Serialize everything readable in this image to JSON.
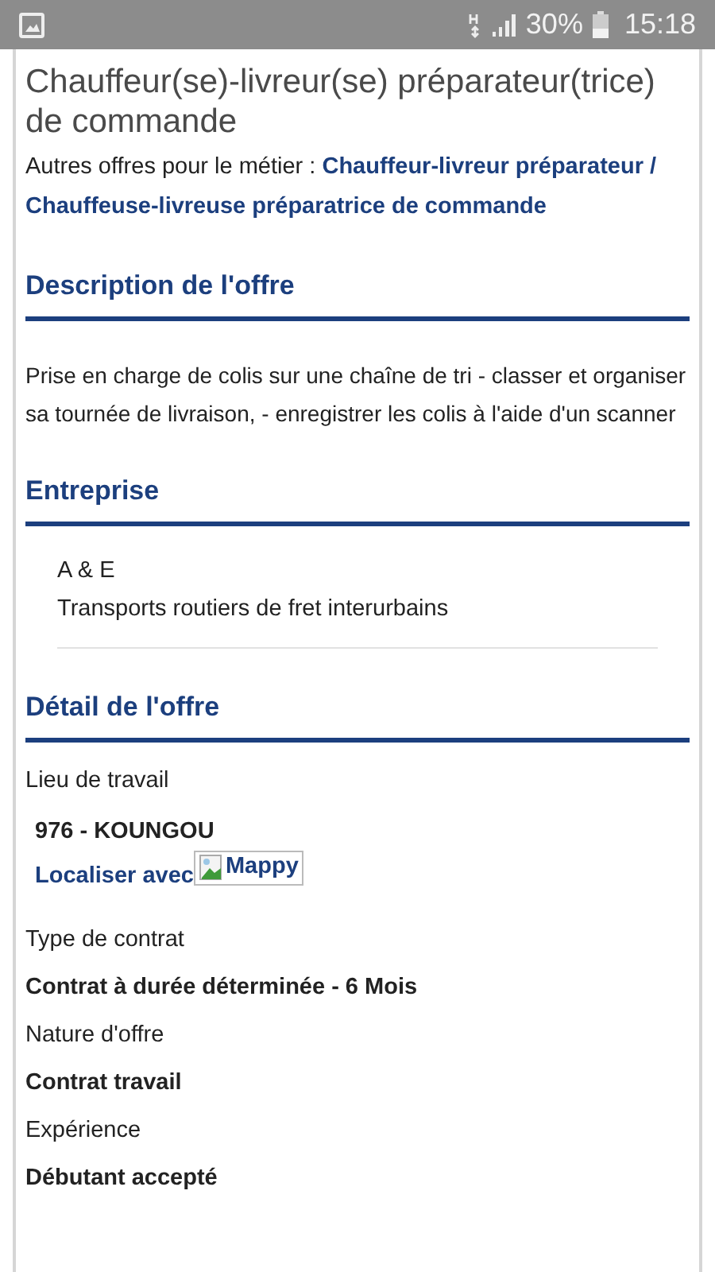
{
  "status_bar": {
    "battery": "30%",
    "time": "15:18"
  },
  "offer": {
    "title": "Chauffeur(se)-livreur(se) préparateur(trice) de commande",
    "other_offers_label": "Autres offres pour le métier :",
    "other_offers_link": "Chauffeur-livreur préparateur / Chauffeuse-livreuse préparatrice de commande"
  },
  "sections": [
    {
      "kind": "text",
      "heading": "Description de l'offre",
      "text": "Prise en charge de colis sur une chaîne de tri - classer et organiser sa tournée de livraison, - enregistrer les colis à l'aide d'un scanner"
    },
    {
      "kind": "company",
      "heading": "Entreprise",
      "name": "A & E",
      "activity": "Transports routiers de fret interurbains"
    },
    {
      "kind": "details",
      "heading": "Détail de l'offre",
      "items": [
        {
          "kind": "location",
          "label": "Lieu de travail",
          "value": "976 - KOUNGOU",
          "link": "Localiser avec",
          "image_alt": "Mappy"
        },
        {
          "kind": "field",
          "label": "Type de contrat",
          "value": "Contrat à durée déterminée - 6 Mois"
        },
        {
          "kind": "field",
          "label": "Nature d'offre",
          "value": "Contrat travail"
        },
        {
          "kind": "field",
          "label": "Expérience",
          "value": "Débutant accepté"
        }
      ]
    }
  ]
}
